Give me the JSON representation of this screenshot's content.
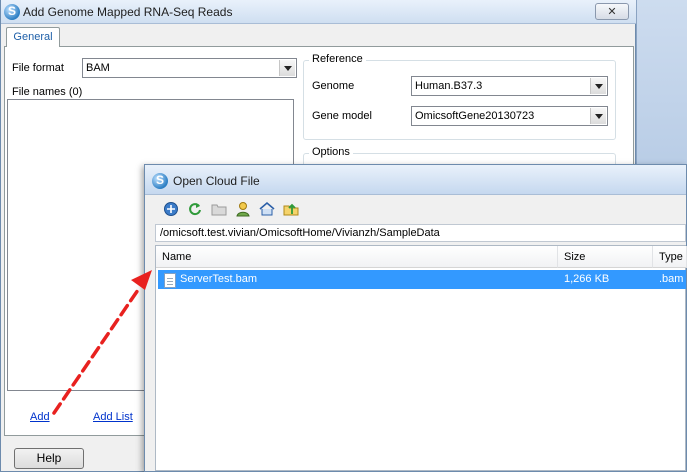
{
  "main_window": {
    "title": "Add Genome Mapped RNA-Seq Reads",
    "close_label": "✕",
    "tab": "General",
    "file_format_label": "File format",
    "file_format_value": "BAM",
    "file_names_label": "File names (0)",
    "reference": {
      "title": "Reference",
      "genome_label": "Genome",
      "genome_value": "Human.B37.3",
      "gene_model_label": "Gene model",
      "gene_model_value": "OmicsoftGene20130723"
    },
    "options_title": "Options",
    "add_link": "Add",
    "add_list_link": "Add List",
    "help_button": "Help"
  },
  "cloud_dialog": {
    "title": "Open Cloud File",
    "toolbar_icons": [
      "connect-icon",
      "refresh-icon",
      "new-folder-icon",
      "user-folder-icon",
      "home-icon",
      "up-folder-icon"
    ],
    "path": "/omicsoft.test.vivian/OmicsoftHome/Vivianzh/SampleData",
    "columns": [
      "Name",
      "Size",
      "Type"
    ],
    "files": [
      {
        "name": "ServerTest.bam",
        "size": "1,266 KB",
        "type": ".bam",
        "selected": true
      }
    ]
  },
  "annotation": {
    "arrow_color": "#e8211f"
  }
}
